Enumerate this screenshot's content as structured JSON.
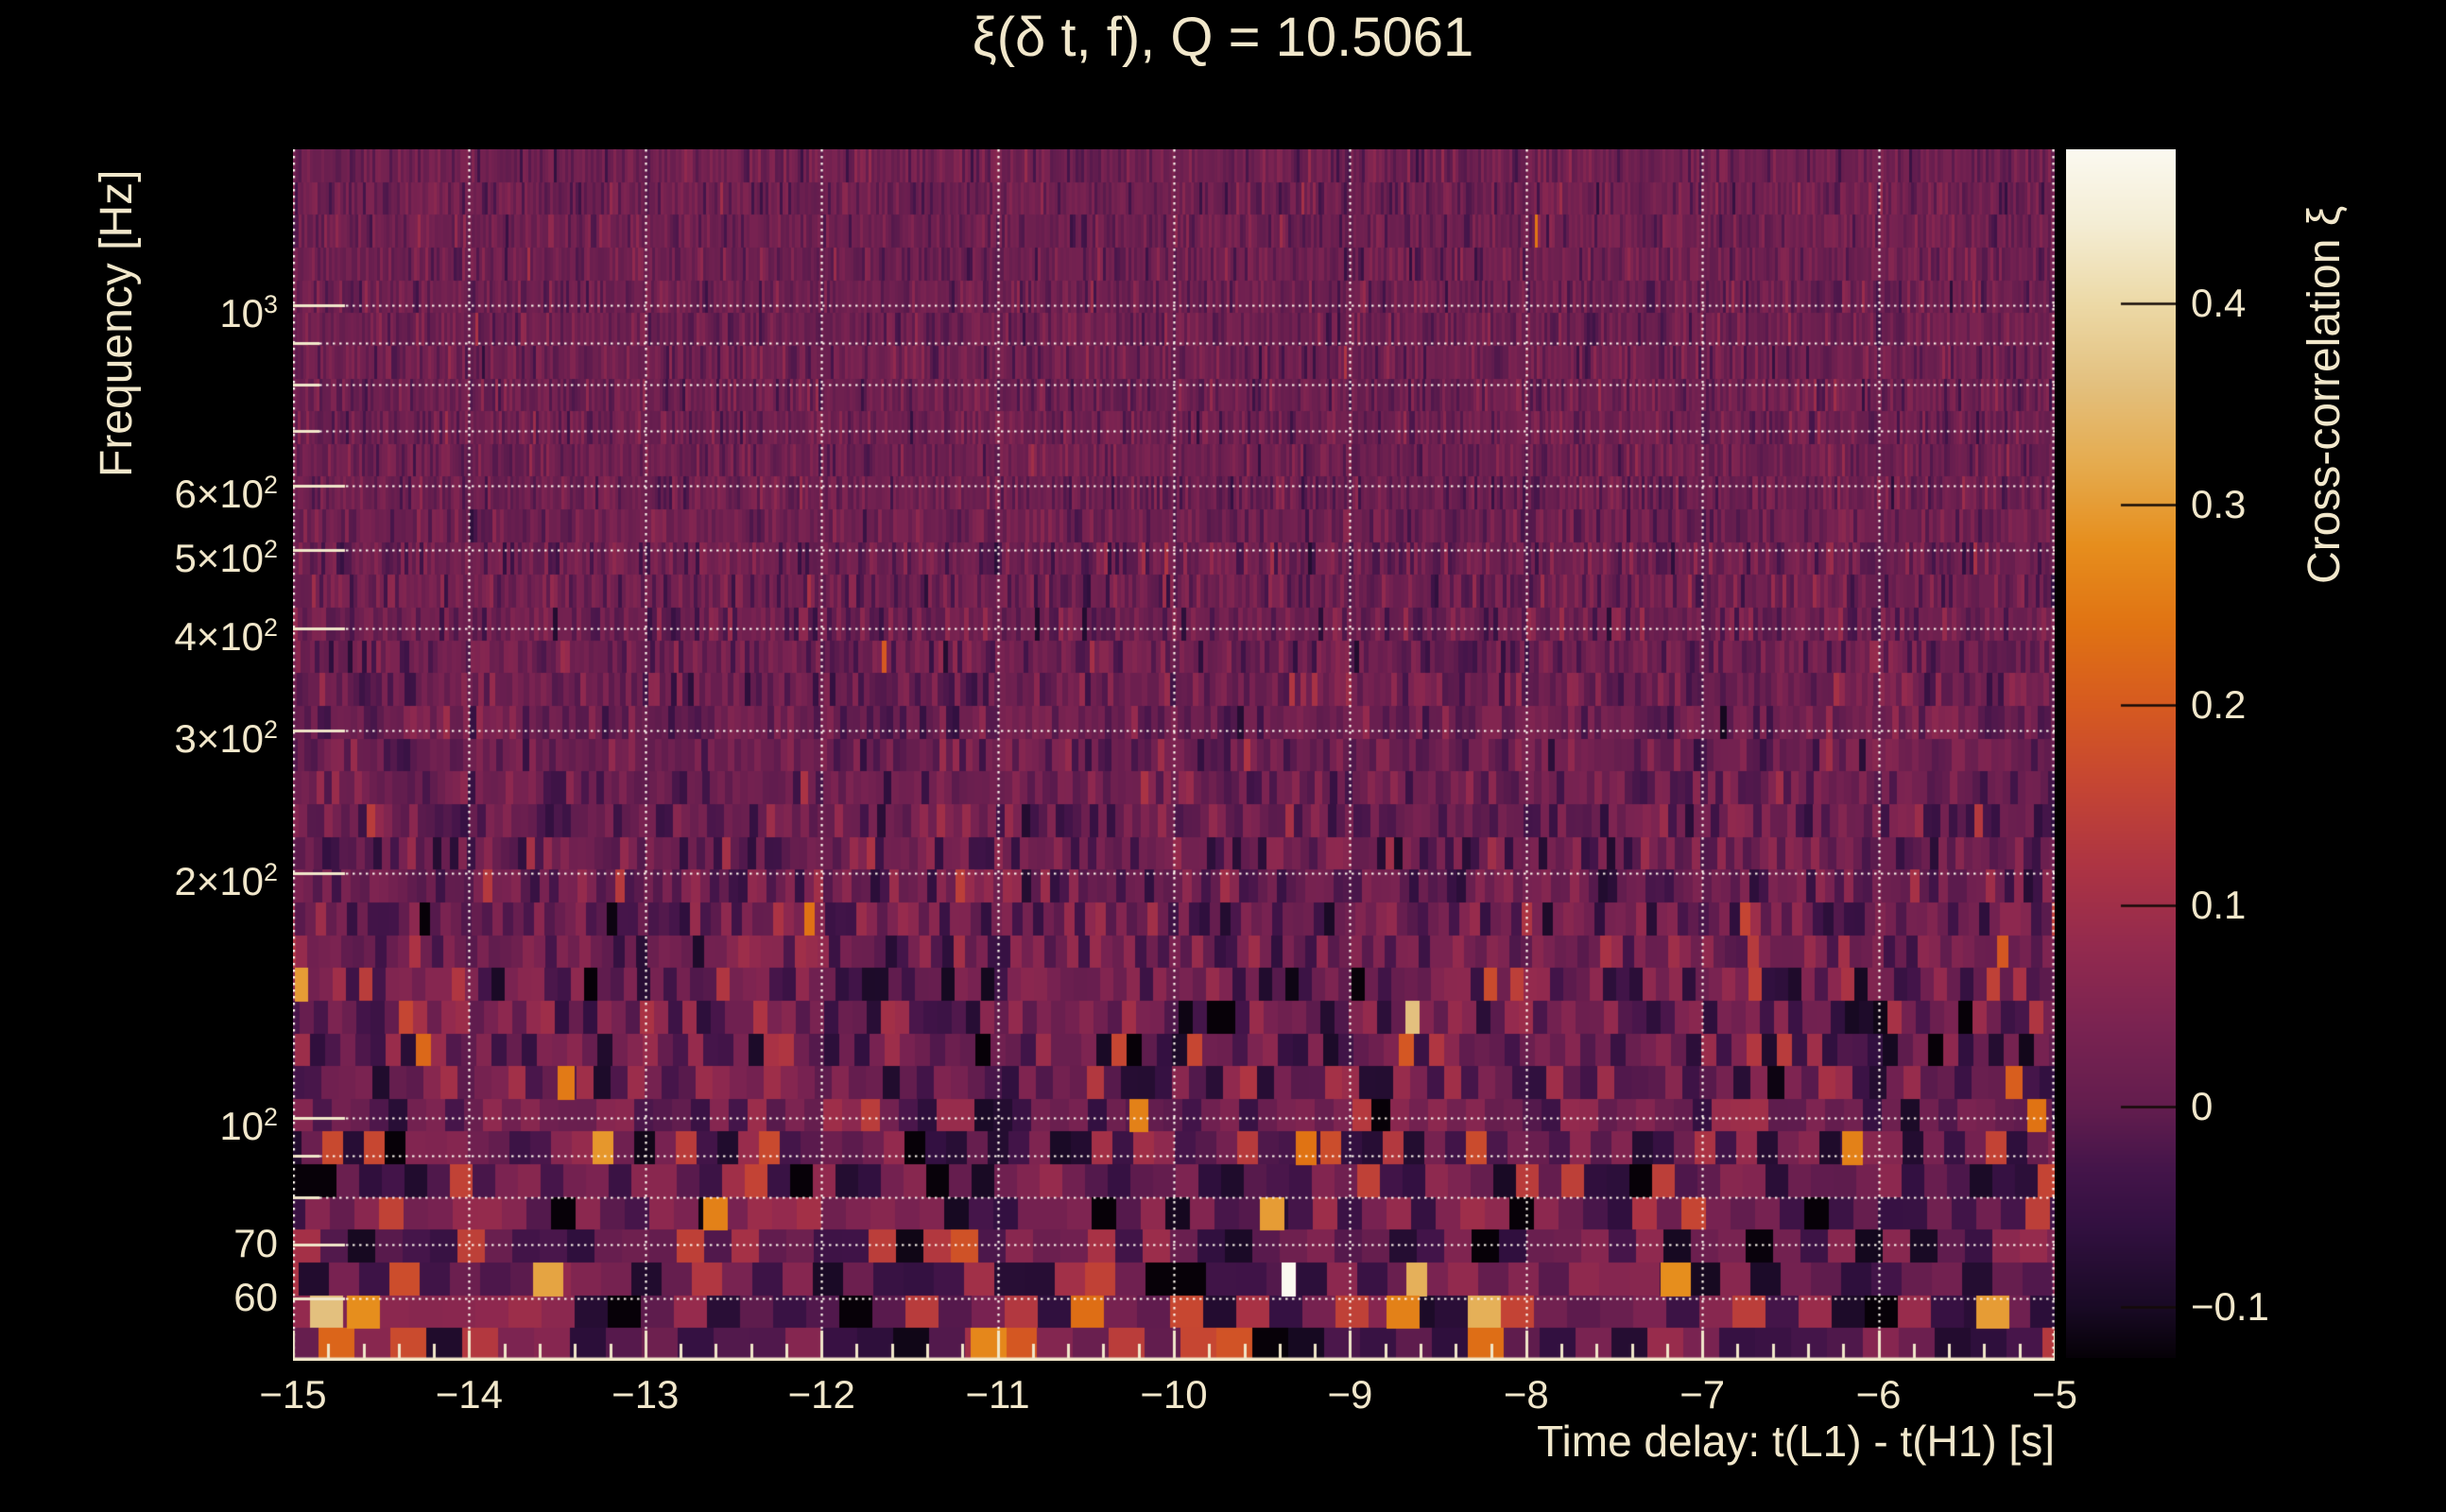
{
  "title": "ξ(δ t, f), Q = 10.5061",
  "colors": {
    "background": "#000000",
    "text": "#f1e7cb",
    "grid": "#fdf8ee",
    "axis": "#f0e6c9",
    "colorbar_tick": "#140b08"
  },
  "chart_data": {
    "type": "heatmap",
    "title": "ξ(δ t, f), Q = 10.5061",
    "xlabel": "Time delay: t(L1) - t(H1) [s]",
    "ylabel": "Frequency [Hz]",
    "colorbar_label": "Cross-correlation ξ",
    "x_range": [
      -15,
      -5
    ],
    "x_scale": "linear",
    "y_range": [
      50.3,
      1556
    ],
    "y_scale": "log",
    "grid": {
      "style": "dotted",
      "x_on": true,
      "y_on": true
    },
    "x_ticks": [
      {
        "t": -15,
        "label": "−15"
      },
      {
        "t": -14,
        "label": "−14"
      },
      {
        "t": -13,
        "label": "−13"
      },
      {
        "t": -12,
        "label": "−12"
      },
      {
        "t": -11,
        "label": "−11"
      },
      {
        "t": -10,
        "label": "−10"
      },
      {
        "t": -9,
        "label": "−9"
      },
      {
        "t": -8,
        "label": "−8"
      },
      {
        "t": -7,
        "label": "−7"
      },
      {
        "t": -6,
        "label": "−6"
      },
      {
        "t": -5,
        "label": "−5"
      }
    ],
    "x_minor_step": 0.2,
    "x_gridlines": [
      -14,
      -13,
      -12,
      -11,
      -10,
      -9,
      -8,
      -7,
      -6
    ],
    "y_ticks": [
      {
        "f": 1000,
        "base": "10",
        "exp": "3"
      },
      {
        "f": 600,
        "base": "6×10",
        "exp": "2"
      },
      {
        "f": 500,
        "base": "5×10",
        "exp": "2"
      },
      {
        "f": 400,
        "base": "4×10",
        "exp": "2"
      },
      {
        "f": 300,
        "base": "3×10",
        "exp": "2"
      },
      {
        "f": 200,
        "base": "2×10",
        "exp": "2"
      },
      {
        "f": 100,
        "base": "10",
        "exp": "2"
      },
      {
        "f": 70,
        "base": "70",
        "exp": ""
      },
      {
        "f": 60,
        "base": "60",
        "exp": ""
      }
    ],
    "y_minor_ticks": [
      900,
      800,
      700,
      90,
      80
    ],
    "y_gridlines": [
      1000,
      900,
      800,
      700,
      600,
      500,
      400,
      300,
      200,
      100,
      90,
      80,
      70,
      60
    ],
    "colorbar": {
      "range": [
        -0.125,
        0.477
      ],
      "ticks": [
        {
          "v": 0.4,
          "label": "0.4"
        },
        {
          "v": 0.3,
          "label": "0.3"
        },
        {
          "v": 0.2,
          "label": "0.2"
        },
        {
          "v": 0.1,
          "label": "0.1"
        },
        {
          "v": 0.0,
          "label": "0"
        },
        {
          "v": -0.1,
          "label": "−0.1"
        }
      ]
    },
    "colormap": [
      [
        -0.125,
        "#060107"
      ],
      [
        -0.1,
        "#190a25"
      ],
      [
        -0.06,
        "#321040"
      ],
      [
        -0.03,
        "#45154a"
      ],
      [
        0.0,
        "#631d4e"
      ],
      [
        0.04,
        "#7a2351"
      ],
      [
        0.08,
        "#932a4e"
      ],
      [
        0.12,
        "#ad3443"
      ],
      [
        0.16,
        "#c54533"
      ],
      [
        0.2,
        "#d65a20"
      ],
      [
        0.24,
        "#e07313"
      ],
      [
        0.28,
        "#e68e1d"
      ],
      [
        0.32,
        "#e5ab4e"
      ],
      [
        0.36,
        "#e3c07e"
      ],
      [
        0.4,
        "#ecd9a6"
      ],
      [
        0.44,
        "#f4edd4"
      ],
      [
        0.477,
        "#fbf9f0"
      ]
    ],
    "texture": {
      "seed": 1337,
      "rows": 37,
      "tile_const": 2000,
      "tile_min": 3,
      "tile_max": 42,
      "value_clamp": [
        -0.124,
        0.36
      ],
      "bands": [
        {
          "f_above": 500,
          "mean": 0.018,
          "sigma": 0.025,
          "spike_prob": 0.006,
          "spike_scale": 0.04
        },
        {
          "f_above": 250,
          "mean": 0.015,
          "sigma": 0.032,
          "spike_prob": 0.012,
          "spike_scale": 0.05
        },
        {
          "f_above": 150,
          "mean": 0.012,
          "sigma": 0.045,
          "spike_prob": 0.022,
          "spike_scale": 0.06
        },
        {
          "f_above": 95,
          "mean": 0.01,
          "sigma": 0.06,
          "spike_prob": 0.045,
          "spike_scale": 0.07
        },
        {
          "f_above": 58,
          "mean": 0.008,
          "sigma": 0.075,
          "spike_prob": 0.065,
          "spike_scale": 0.08
        },
        {
          "f_above": 0,
          "mean": 0.015,
          "sigma": 0.08,
          "spike_prob": 0.11,
          "spike_scale": 0.09
        }
      ],
      "hotspots": [
        {
          "t": -9.35,
          "f": 63,
          "v": 0.477,
          "w": 15
        },
        {
          "t": -9.44,
          "f": 74,
          "v": 0.3
        },
        {
          "t": -9.25,
          "f": 88,
          "v": 0.24
        },
        {
          "t": -8.62,
          "f": 66,
          "v": 0.33,
          "w": 22
        },
        {
          "t": -8.7,
          "f": 57,
          "v": 0.26
        },
        {
          "t": -13.55,
          "f": 62,
          "v": 0.31
        },
        {
          "t": -13.45,
          "f": 110,
          "v": 0.25
        },
        {
          "t": -14.95,
          "f": 150,
          "v": 0.3
        },
        {
          "t": -14.6,
          "f": 57,
          "v": 0.28
        },
        {
          "t": -12.6,
          "f": 75,
          "v": 0.26
        },
        {
          "t": -11.05,
          "f": 55,
          "v": 0.27
        },
        {
          "t": -10.2,
          "f": 98,
          "v": 0.26
        },
        {
          "t": -7.15,
          "f": 64,
          "v": 0.28
        },
        {
          "t": -6.15,
          "f": 88,
          "v": 0.26
        },
        {
          "t": -5.35,
          "f": 60,
          "v": 0.3
        },
        {
          "t": -5.1,
          "f": 100,
          "v": 0.24
        }
      ]
    }
  }
}
